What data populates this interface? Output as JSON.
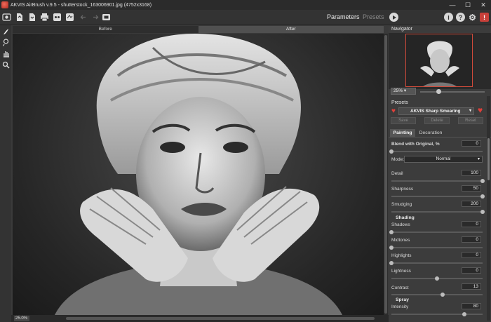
{
  "window": {
    "title": "AKVIS AirBrush v.9.5 - shutterstock_163006901.jpg (4752x3168)",
    "controls": [
      "—",
      "☐",
      "✕"
    ]
  },
  "toolbar": {
    "buttons": [
      "home-icon",
      "open-file-icon",
      "save-file-icon",
      "print-icon",
      "share-icon",
      "batch-icon",
      "undo-icon",
      "redo-icon",
      "crop-icon"
    ],
    "tabs": {
      "parameters": "Parameters",
      "presets": "Presets"
    },
    "right_icons": {
      "info": "i",
      "help": "?",
      "settings": "⚙",
      "notify": "!"
    }
  },
  "view": {
    "before": "Before",
    "after": "After",
    "zoom": "25.0%"
  },
  "navigator": {
    "title": "Navigator",
    "zoom": "25%"
  },
  "presets": {
    "title": "Presets",
    "selected": "AKVIS Sharp Smearing",
    "buttons": {
      "save": "Save",
      "delete": "Delete",
      "reset": "Reset"
    }
  },
  "panel_tabs": {
    "painting": "Painting",
    "decoration": "Decoration"
  },
  "params": {
    "blend": {
      "label": "Blend with Original, %",
      "value": "0",
      "level": 0
    },
    "mode": {
      "label": "Mode:",
      "value": "Normal"
    },
    "detail": {
      "label": "Detail",
      "value": "100",
      "level": 1.0
    },
    "sharpness": {
      "label": "Sharpness",
      "value": "50",
      "level": 1.0
    },
    "smudging": {
      "label": "Smudging",
      "value": "200",
      "level": 1.0
    },
    "shading_title": "Shading",
    "shadows": {
      "label": "Shadows",
      "value": "0",
      "level": 0
    },
    "midtones": {
      "label": "Midtones",
      "value": "0",
      "level": 0
    },
    "highlights": {
      "label": "Highlights",
      "value": "0",
      "level": 0
    },
    "lightness": {
      "label": "Lightness",
      "value": "0",
      "level": 0.5
    },
    "contrast": {
      "label": "Contrast",
      "value": "13",
      "level": 0.56
    },
    "spray_title": "Spray",
    "intensity": {
      "label": "Intensity",
      "value": "80",
      "level": 0.8
    }
  },
  "colors": {
    "accent": "#d04a3a",
    "heart": "#e0403a",
    "panel": "#3c3c3c"
  }
}
